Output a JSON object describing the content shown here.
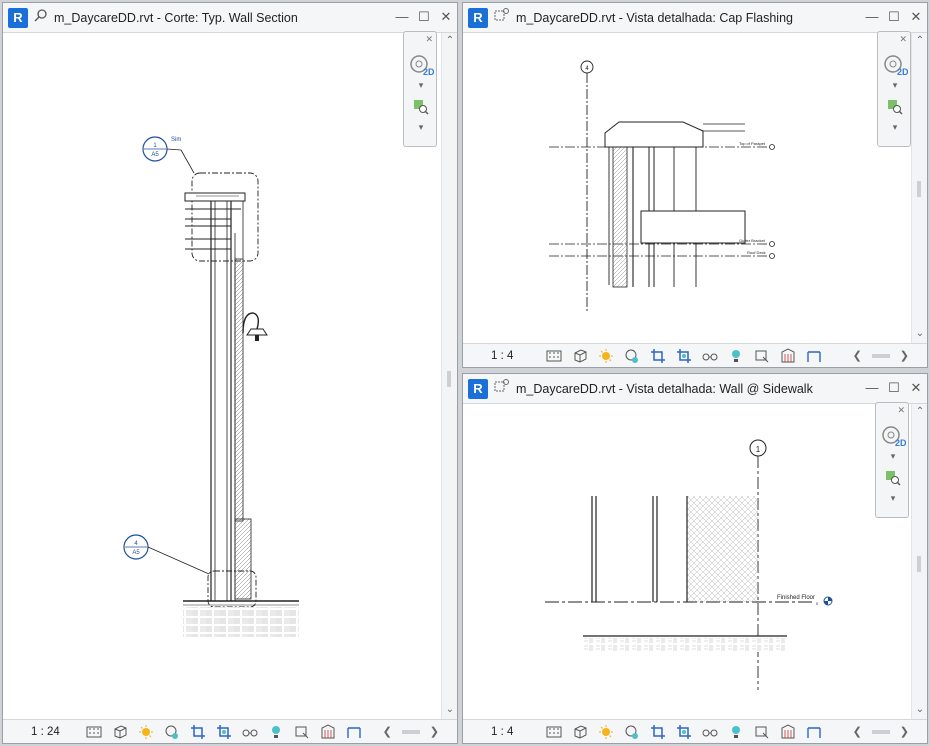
{
  "views": {
    "left": {
      "title": "m_DaycareDD.rvt - Corte: Typ. Wall Section",
      "scale": "1 : 24",
      "tags": [
        {
          "num": "1",
          "sheet": "A5",
          "note": "Sim"
        },
        {
          "num": "4",
          "sheet": "A5"
        }
      ]
    },
    "top_right": {
      "title": "m_DaycareDD.rvt - Vista detalhada: Cap Flashing",
      "scale": "1 : 4",
      "grid": "4",
      "levels": [
        "Top of Parapet",
        "Gutter Bracket",
        "Roof Deck"
      ]
    },
    "bottom_right": {
      "title": "m_DaycareDD.rvt - Vista detalhada: Wall @ Sidewalk",
      "scale": "1 : 4",
      "grid": "1",
      "level": "Finished Floor",
      "level_value": "0"
    }
  },
  "navbar": {
    "label_2d": "2D"
  },
  "icons": [
    "revit-logo",
    "section-view-icon",
    "detail-view-icon",
    "minimize-icon",
    "restore-icon",
    "close-icon",
    "detail-level-icon",
    "visual-style-icon",
    "sun-path-icon",
    "shadows-icon",
    "crop-view-icon",
    "show-crop-icon",
    "temporary-hide-icon",
    "reveal-hidden-icon",
    "temporary-properties-icon",
    "analytical-model-icon",
    "highlight-displacement-icon",
    "constraints-icon",
    "steering-wheel-icon",
    "zoom-region-icon"
  ],
  "colors": {
    "revit_blue": "#1a6fd8",
    "tag_blue": "#1f4fa0",
    "section_blue": "#2c66c7"
  }
}
